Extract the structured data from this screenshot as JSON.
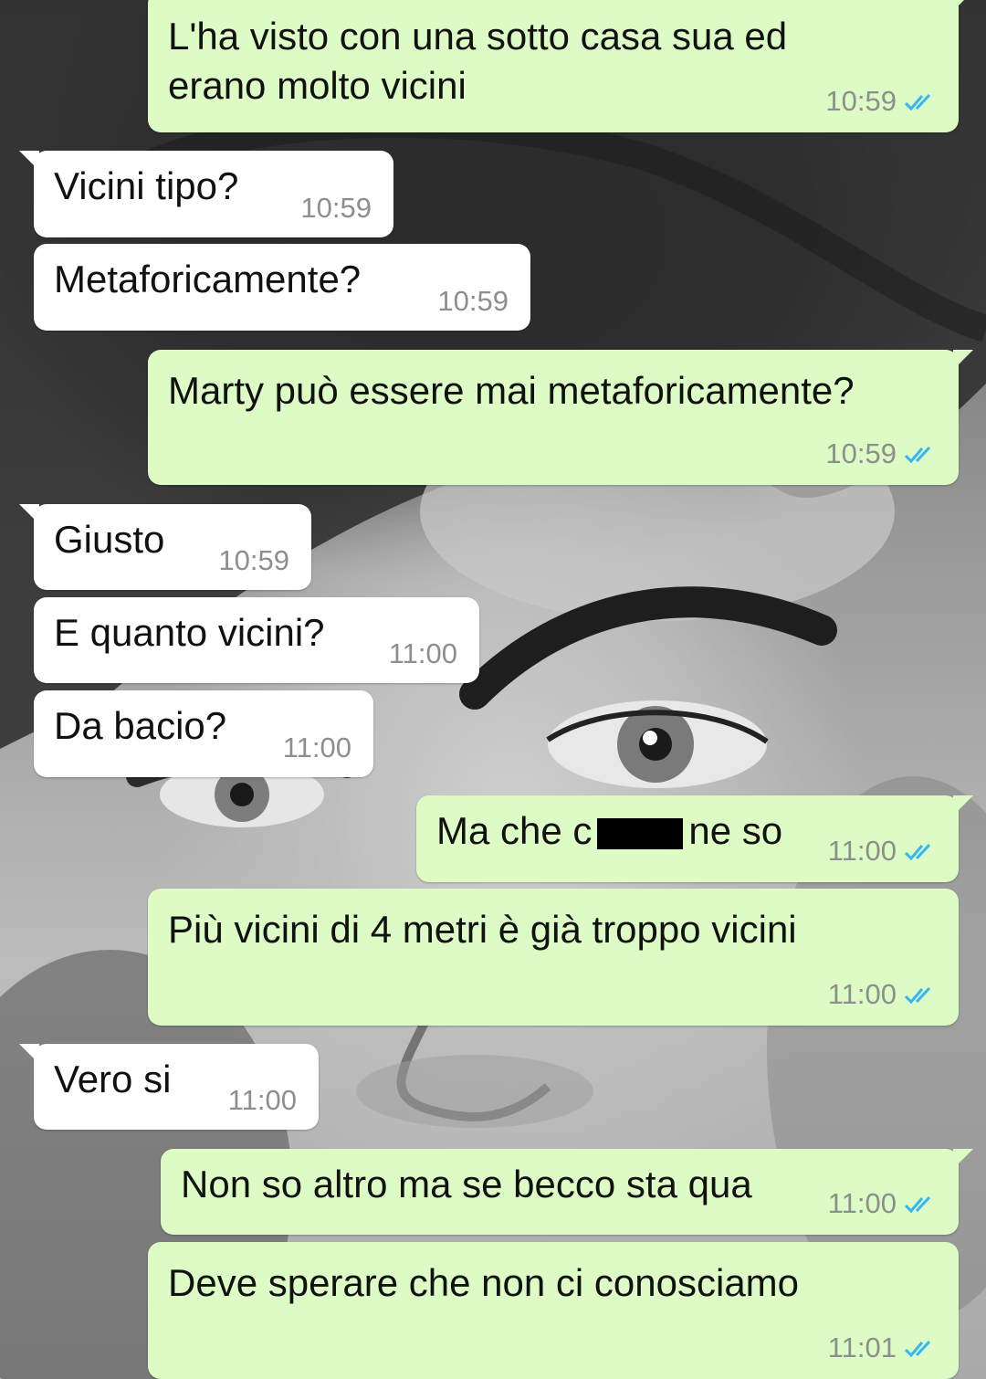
{
  "colors": {
    "incoming_bubble": "#ffffff",
    "outgoing_bubble": "#ddfbc5",
    "timestamp": "#8c8f8c",
    "read_ticks": "#34b7f1"
  },
  "messages": [
    {
      "direction": "outgoing",
      "lines": [
        "L'ha visto con una sotto casa sua ed",
        "erano molto vicini"
      ],
      "time": "10:59",
      "read": true
    },
    {
      "direction": "incoming",
      "text": "Vicini tipo?",
      "time": "10:59"
    },
    {
      "direction": "incoming",
      "text": "Metaforicamente?",
      "time": "10:59"
    },
    {
      "direction": "outgoing",
      "text": "Marty può essere mai metaforicamente?",
      "time": "10:59",
      "read": true
    },
    {
      "direction": "incoming",
      "text": "Giusto",
      "time": "10:59"
    },
    {
      "direction": "incoming",
      "text": "E quanto vicini?",
      "time": "11:00"
    },
    {
      "direction": "incoming",
      "text": "Da bacio?",
      "time": "11:00"
    },
    {
      "direction": "outgoing",
      "text_before": "Ma che c",
      "text_after": "ne so",
      "redacted": true,
      "time": "11:00",
      "read": true
    },
    {
      "direction": "outgoing",
      "text": "Più vicini di 4 metri è già troppo vicini",
      "time": "11:00",
      "read": true
    },
    {
      "direction": "incoming",
      "text": "Vero si",
      "time": "11:00"
    },
    {
      "direction": "outgoing",
      "text": "Non so altro ma se becco sta qua",
      "time": "11:00",
      "read": true
    },
    {
      "direction": "outgoing",
      "text": "Deve sperare che non ci conosciamo",
      "time": "11:01",
      "read": true
    }
  ]
}
